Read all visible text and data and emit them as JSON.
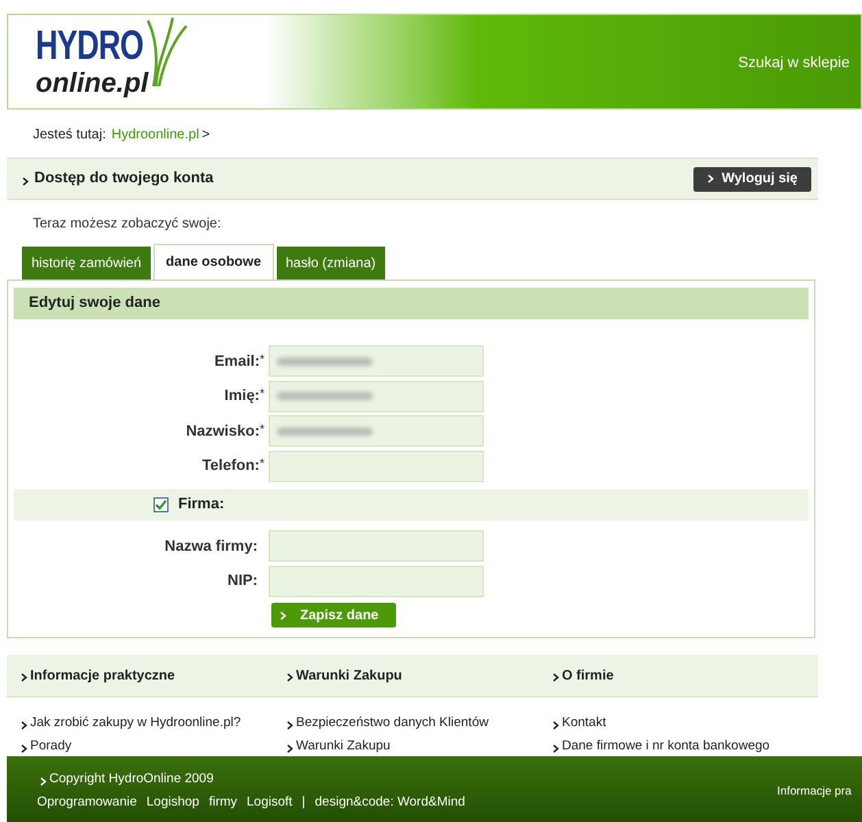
{
  "header": {
    "logo_top": "HYDRO",
    "logo_bottom": "online.pl",
    "search_link": "Szukaj w sklepie"
  },
  "breadcrumb": {
    "label": "Jesteś tutaj:",
    "link": "Hydroonline.pl",
    "separator": ">"
  },
  "account_bar": {
    "title": "Dostęp do twojego konta",
    "logout": "Wyloguj się"
  },
  "intro": "Teraz możesz zobaczyć swoje:",
  "tabs": [
    {
      "label": "historię zamówień",
      "selected": false
    },
    {
      "label": "dane osobowe",
      "selected": true
    },
    {
      "label": "hasło (zmiana)",
      "selected": false
    }
  ],
  "form": {
    "title": "Edytuj swoje dane",
    "fields": [
      {
        "label": "Email:",
        "mark": "*",
        "redacted": true
      },
      {
        "label": "Imię:",
        "mark": "*",
        "redacted": true
      },
      {
        "label": "Nazwisko:",
        "mark": "*",
        "redacted": true
      },
      {
        "label": "Telefon:",
        "mark": "*",
        "redacted": false
      }
    ],
    "company": {
      "label": "Firma:",
      "checked": true
    },
    "company_fields": [
      {
        "label": "Nazwa firmy:",
        "redacted": false
      },
      {
        "label": "NIP:",
        "redacted": false
      }
    ],
    "submit": "Zapisz dane"
  },
  "footer_columns": [
    {
      "title": "Informacje praktyczne",
      "links": [
        "Jak zrobić zakupy w Hydroonline.pl?",
        "Porady"
      ]
    },
    {
      "title": "Warunki Zakupu",
      "links": [
        "Bezpieczeństwo danych Klientów",
        "Warunki Zakupu"
      ]
    },
    {
      "title": "O firmie",
      "links": [
        "Kontakt",
        "Dane firmowe i nr konta bankowego"
      ]
    }
  ],
  "bottom_bar": {
    "copyright": "Copyright HydroOnline 2009",
    "credits": [
      "Oprogramowanie",
      "Logishop",
      "firmy",
      "Logisoft",
      "|",
      "design&code: Word&Mind"
    ],
    "right_link": "Informacje pra"
  }
}
